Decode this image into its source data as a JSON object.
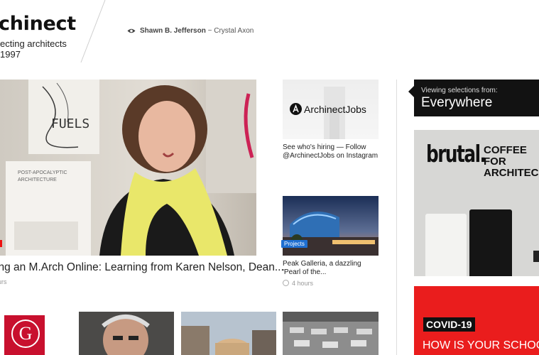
{
  "header": {
    "logo_title": "chinect",
    "logo_tagline_1": "ecting architects",
    "logo_tagline_2": "1997",
    "viewer_name": "Shawn B. Jefferson",
    "viewer_sep": " ~ ",
    "viewer_other": "Crystal Axon"
  },
  "hero": {
    "title": "ing an M.Arch Online: Learning from Karen Nelson, Dean...",
    "meta": "ours",
    "poster_line_1": "FUELS",
    "poster_line_2": "POST-APOCALYPTIC",
    "poster_line_3": "ARCHITECTURE"
  },
  "cards": [
    {
      "logo_text": "ArchinectJobs",
      "text": "See who's hiring — Follow @ArchinectJobs on Instagram"
    },
    {
      "badge": "Projects",
      "text": "Peak Galleria, a dazzling 'Pearl of the...",
      "meta": "4 hours"
    }
  ],
  "sidebar": {
    "tooltip_small": "Viewing selections from:",
    "tooltip_big": "Everywhere",
    "ad1_brand": "brutal.",
    "ad1_line1": "COFFEE",
    "ad1_line2": "FOR",
    "ad1_line3": "ARCHITEC",
    "ad2_tag": "COVID-19",
    "ad2_line": "HOW IS YOUR SCHOO"
  },
  "bottom": {
    "g_letter": "G"
  },
  "colors": {
    "accent_red": "#ea1d1d",
    "badge_blue": "#1f6fd1",
    "tooltip_bg": "#121212"
  }
}
